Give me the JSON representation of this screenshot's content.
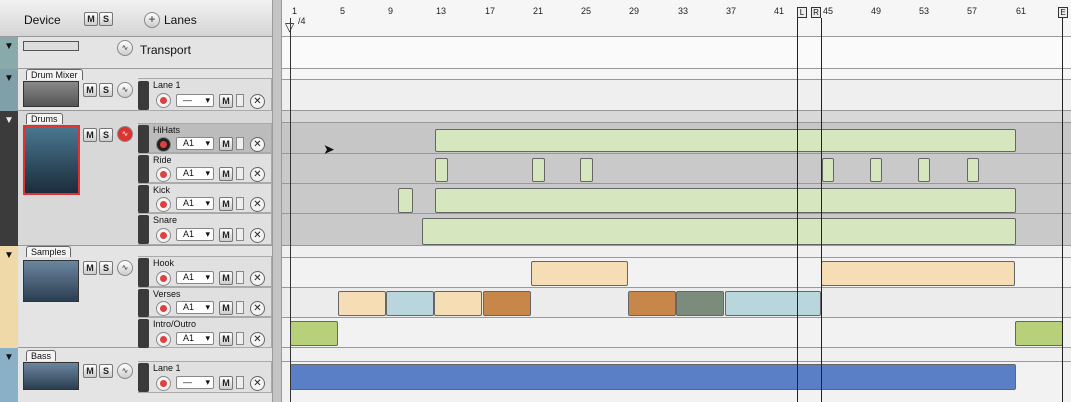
{
  "header": {
    "device_label": "Device",
    "m": "M",
    "s": "S",
    "lanes_label": "Lanes",
    "plus": "+"
  },
  "transport": {
    "label": "Transport"
  },
  "ruler": {
    "marks": [
      "1",
      "5",
      "9",
      "13",
      "17",
      "21",
      "25",
      "29",
      "33",
      "37",
      "41",
      "45",
      "49",
      "53",
      "57",
      "61"
    ],
    "sig": "/4",
    "loop_left": "L",
    "loop_right": "R",
    "end": "E"
  },
  "devices": [
    {
      "tab": "Drum Mixer",
      "lanes": [
        {
          "name": "Lane 1",
          "slot": "—"
        }
      ]
    },
    {
      "tab": "Drums",
      "lanes": [
        {
          "name": "HiHats",
          "slot": "A1"
        },
        {
          "name": "Ride",
          "slot": "A1"
        },
        {
          "name": "Kick",
          "slot": "A1"
        },
        {
          "name": "Snare",
          "slot": "A1"
        }
      ]
    },
    {
      "tab": "Samples",
      "lanes": [
        {
          "name": "Hook",
          "slot": "A1"
        },
        {
          "name": "Verses",
          "slot": "A1"
        },
        {
          "name": "Intro/Outro",
          "slot": "A1"
        }
      ]
    },
    {
      "tab": "Bass",
      "lanes": [
        {
          "name": "Lane 1",
          "slot": "—"
        }
      ]
    }
  ],
  "colors": {
    "drums_clip": "#d6e7bf",
    "samples_light": "#f5ddb5",
    "samples_blue": "#b9d6dc",
    "samples_orange": "#c8874a",
    "samples_gray": "#7c8c7c",
    "intro": "#b9d07a",
    "bass": "#5a7fc7",
    "drum_bg": "#c8c8c8"
  }
}
